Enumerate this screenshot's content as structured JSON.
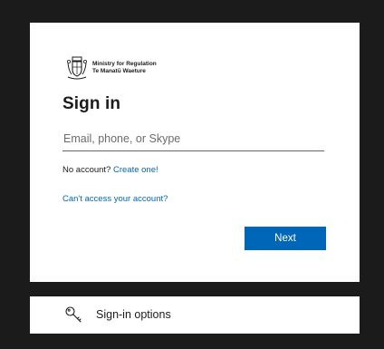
{
  "logo": {
    "line1": "Ministry for Regulation",
    "line2": "Te Manatū Waeture"
  },
  "signin": {
    "title": "Sign in",
    "email_placeholder": "Email, phone, or Skype",
    "email_value": "",
    "no_account_text": "No account? ",
    "create_link": "Create one!",
    "cant_access_link": "Can't access your account?",
    "next_label": "Next"
  },
  "options": {
    "label": "Sign-in options"
  },
  "colors": {
    "background": "#1b1b1b",
    "card": "#ffffff",
    "accent": "#0067b8",
    "text": "#1b1b1b"
  },
  "icons": {
    "crest": "nz-coat-of-arms-icon",
    "options": "key-icon"
  }
}
